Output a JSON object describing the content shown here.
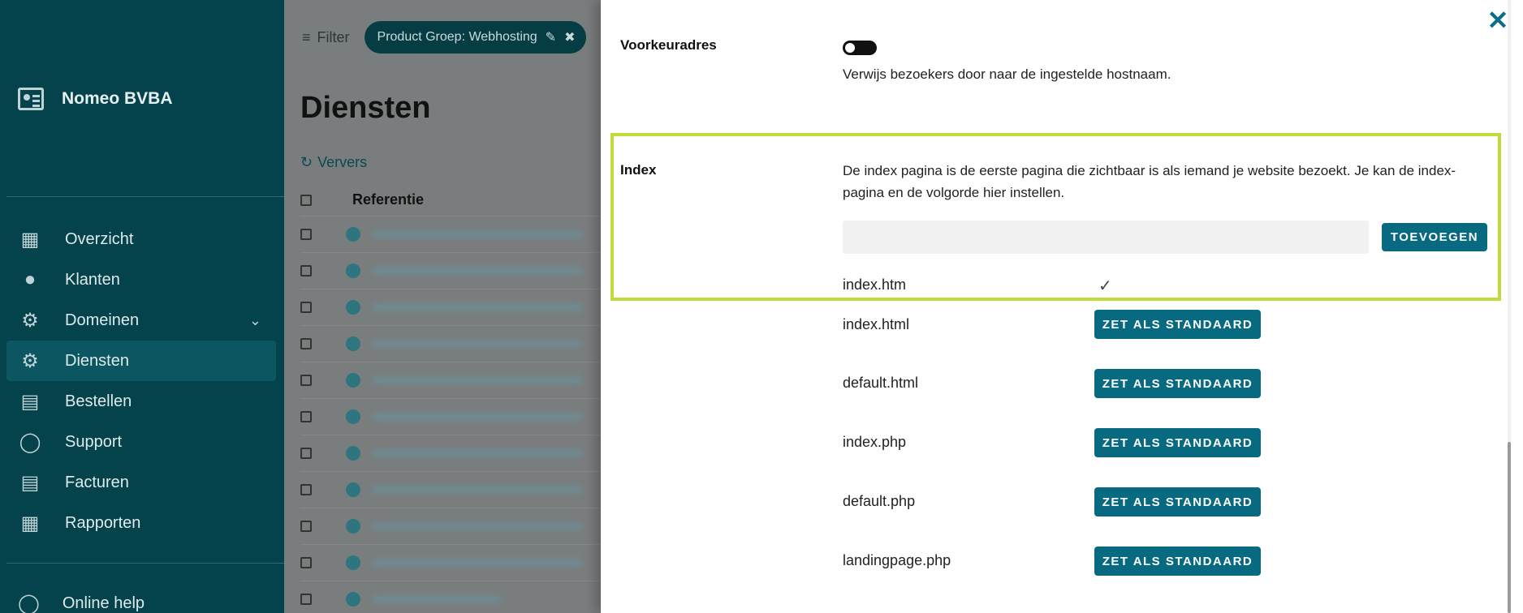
{
  "sidebar": {
    "brand": "Nomeo BVBA",
    "items": [
      {
        "label": "Overzicht",
        "icon": "search-document-icon"
      },
      {
        "label": "Klanten",
        "icon": "users-icon"
      },
      {
        "label": "Domeinen",
        "icon": "gear-icon"
      },
      {
        "label": "Diensten",
        "icon": "gear-settings-icon"
      },
      {
        "label": "Bestellen",
        "icon": "basket-icon"
      },
      {
        "label": "Support",
        "icon": "chat-icon"
      },
      {
        "label": "Facturen",
        "icon": "invoice-icon"
      },
      {
        "label": "Rapporten",
        "icon": "report-icon"
      }
    ],
    "help": "Online help",
    "active": "Diensten",
    "bg_color": "#04434c"
  },
  "main": {
    "filter_label": "Filter",
    "chip_label": "Product Groep: Webhosting",
    "title": "Diensten",
    "refresh_label": "Ververs",
    "column_reference": "Referentie"
  },
  "panel": {
    "preferred_label": "Voorkeuradres",
    "preferred_desc": "Verwijs bezoekers door naar de ingestelde hostnaam.",
    "index_label": "Index",
    "index_desc": "De index pagina is de eerste pagina die zichtbaar is als iemand je website bezoekt. Je kan de index-pagina en de volgorde hier instellen.",
    "add_input_value": "",
    "add_button": "TOEVOEGEN",
    "default_check": "✓",
    "set_default_button": "ZET ALS STANDAARD",
    "index_files": [
      "index.htm",
      "index.html",
      "default.html",
      "index.php",
      "default.php",
      "landingpage.php"
    ],
    "accent_color": "#076a80",
    "highlight_color": "#bfdc3a"
  }
}
